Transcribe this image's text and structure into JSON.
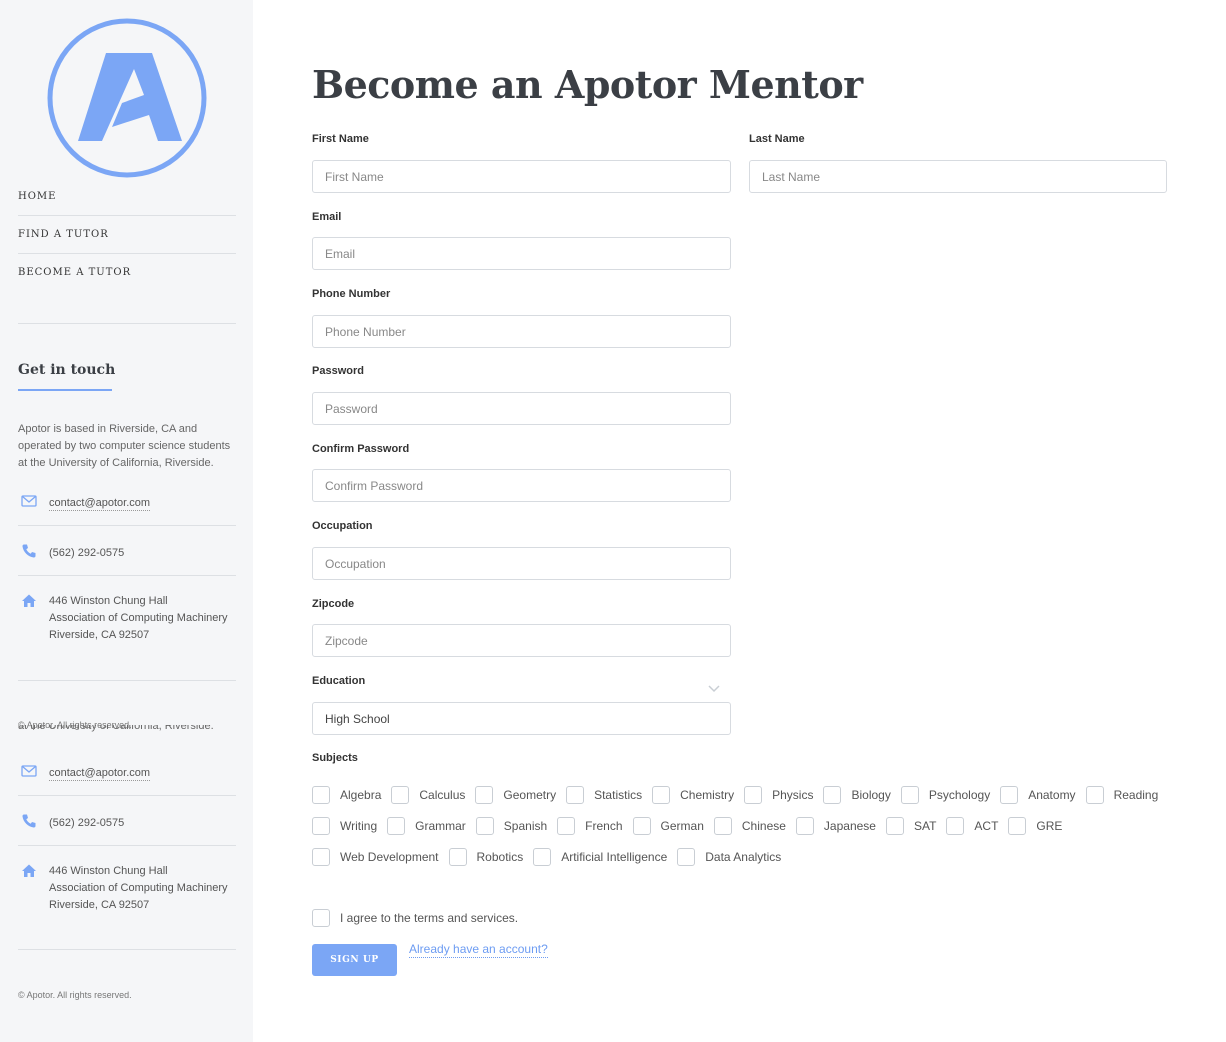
{
  "brand": {
    "accent_color": "#7ba6f5",
    "logo_letter": "A"
  },
  "nav": {
    "items": [
      {
        "label": "HOME"
      },
      {
        "label": "FIND A TUTOR"
      },
      {
        "label": "BECOME A TUTOR"
      }
    ]
  },
  "contact": {
    "heading": "Get in touch",
    "about": "Apotor is based in Riverside, CA and operated by two computer science students at the University of California, Riverside.",
    "about_clipped": "at the University of California, Riverside.",
    "email": "contact@apotor.com",
    "phone": "(562) 292-0575",
    "address_lines": [
      "446 Winston Chung Hall",
      "Association of Computing Machinery",
      "Riverside, CA 92507"
    ],
    "copyright": "© Apotor. All rights reserved."
  },
  "form": {
    "title": "Become an Apotor Mentor",
    "fields": {
      "first_name": {
        "label": "First Name",
        "placeholder": "First Name"
      },
      "last_name": {
        "label": "Last Name",
        "placeholder": "Last Name"
      },
      "email": {
        "label": "Email",
        "placeholder": "Email"
      },
      "phone": {
        "label": "Phone Number",
        "placeholder": "Phone Number"
      },
      "password": {
        "label": "Password",
        "placeholder": "Password"
      },
      "confirm_password": {
        "label": "Confirm Password",
        "placeholder": "Confirm Password"
      },
      "occupation": {
        "label": "Occupation",
        "placeholder": "Occupation"
      },
      "zipcode": {
        "label": "Zipcode",
        "placeholder": "Zipcode"
      },
      "education": {
        "label": "Education",
        "value": "High School"
      }
    },
    "subjects_label": "Subjects",
    "subject_rows": [
      [
        "Algebra",
        "Calculus",
        "Geometry",
        "Statistics",
        "Chemistry",
        "Physics",
        "Biology",
        "Psychology",
        "Anatomy",
        "Reading"
      ],
      [
        "Writing",
        "Grammar",
        "Spanish",
        "French",
        "German",
        "Chinese",
        "Japanese",
        "SAT",
        "ACT",
        "GRE"
      ],
      [
        "Web Development",
        "Robotics",
        "Artificial Intelligence",
        "Data Analytics"
      ]
    ],
    "terms_label": "I agree to the terms and services.",
    "submit_label": "SIGN UP",
    "account_link": "Already have an account?"
  }
}
